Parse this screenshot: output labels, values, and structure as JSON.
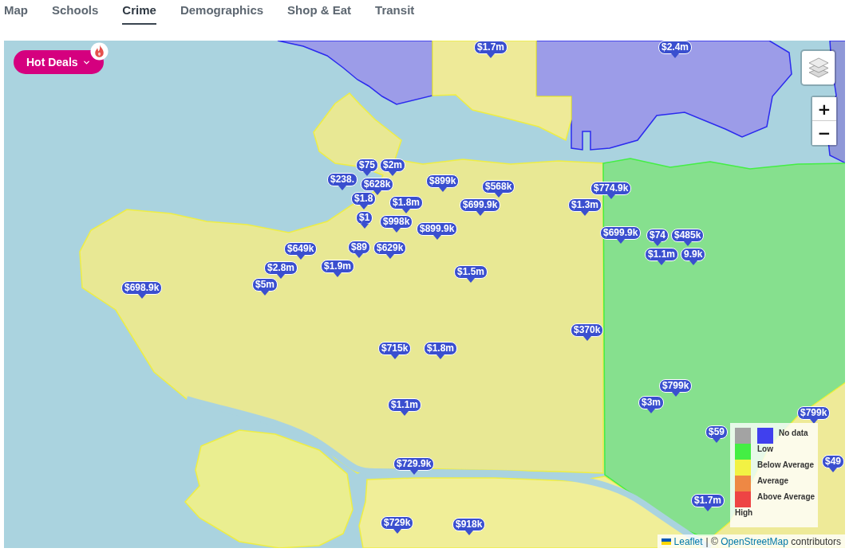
{
  "tabs": [
    {
      "label": "Map",
      "selected": false
    },
    {
      "label": "Schools",
      "selected": false
    },
    {
      "label": "Crime",
      "selected": true
    },
    {
      "label": "Demographics",
      "selected": false
    },
    {
      "label": "Shop & Eat",
      "selected": false
    },
    {
      "label": "Transit",
      "selected": false
    }
  ],
  "map": {
    "hot_deals": {
      "label": "Hot Deals"
    },
    "zoom": {
      "zoom_in": "+",
      "zoom_out": "−"
    },
    "price_markers": [
      {
        "price": "$1.7m"
      },
      {
        "price": "$2.4m"
      },
      {
        "price": "$75"
      },
      {
        "price": "$2m"
      },
      {
        "price": "$238."
      },
      {
        "price": "$628k"
      },
      {
        "price": "$899k"
      },
      {
        "price": "$568k"
      },
      {
        "price": "$774.9k"
      },
      {
        "price": "$1.8"
      },
      {
        "price": "$1.8m"
      },
      {
        "price": "$699.9k"
      },
      {
        "price": "$1.3m"
      },
      {
        "price": "$1"
      },
      {
        "price": "$998k"
      },
      {
        "price": "$899.9k"
      },
      {
        "price": "$699.9k"
      },
      {
        "price": "$74"
      },
      {
        "price": "$485k"
      },
      {
        "price": "$649k"
      },
      {
        "price": "$89"
      },
      {
        "price": "$629k"
      },
      {
        "price": "$1.1m"
      },
      {
        "price": "9.9k"
      },
      {
        "price": "$2.8m"
      },
      {
        "price": "$1.9m"
      },
      {
        "price": "$1.5m"
      },
      {
        "price": "$698.9k"
      },
      {
        "price": "$5m"
      },
      {
        "price": "$370k"
      },
      {
        "price": "$715k"
      },
      {
        "price": "$1.8m"
      },
      {
        "price": "$799k"
      },
      {
        "price": "$1.1m"
      },
      {
        "price": "$3m"
      },
      {
        "price": "$799k"
      },
      {
        "price": "$59"
      },
      {
        "price": "$729.9k"
      },
      {
        "price": "$49"
      },
      {
        "price": "$1.7m"
      },
      {
        "price": "$729k"
      },
      {
        "price": "$918k"
      }
    ],
    "legend": {
      "no_data": {
        "label": "No data",
        "color": "#4040ee"
      },
      "swatches": [
        {
          "color": "#a3a3a3"
        },
        {
          "color": "#44ee44"
        },
        {
          "color": "#f2f244"
        },
        {
          "color": "#ee8844"
        },
        {
          "color": "#ee4444"
        }
      ],
      "labels": [
        "Low",
        "Below Average",
        "Average",
        "Above Average",
        "High"
      ]
    },
    "attribution": {
      "leaflet": "Leaflet",
      "prefix": "| ©",
      "osm": "OpenStreetMap",
      "suffix": "contributors"
    }
  }
}
